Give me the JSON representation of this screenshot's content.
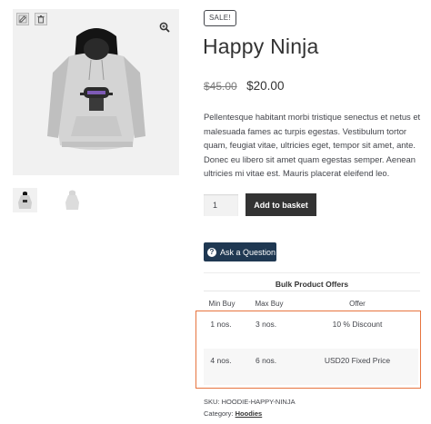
{
  "gallery": {
    "main_alt": "Happy Ninja hoodie product image",
    "tool_icons": [
      "edit-icon",
      "trash-icon"
    ],
    "zoom_icon": "zoom-icon",
    "thumbnails": [
      "hoodie-front-thumbnail",
      "hoodie-back-thumbnail"
    ]
  },
  "product": {
    "badge": "Sale!",
    "title": "Happy Ninja",
    "price_old": "$45.00",
    "price_new": "$20.00",
    "description": "Pellentesque habitant morbi tristique senectus et netus et malesuada fames ac turpis egestas. Vestibulum tortor quam, feugiat vitae, ultricies eget, tempor sit amet, ante. Donec eu libero sit amet quam egestas semper. Aenean ultricies mi vitae est. Mauris placerat eleifend leo.",
    "quantity": "1",
    "add_to_basket": "Add to basket",
    "ask_question": "Ask a Question"
  },
  "offers": {
    "title": "Bulk Product Offers",
    "headers": [
      "Min Buy",
      "Max Buy",
      "Offer"
    ],
    "rows": [
      {
        "min": "1 nos.",
        "max": "3 nos.",
        "offer": "10 % Discount"
      },
      {
        "min": "4 nos.",
        "max": "6 nos.",
        "offer": "USD20 Fixed Price"
      }
    ],
    "highlight_color": "#e7743e"
  },
  "meta": {
    "sku_label": "SKU:",
    "sku_value": "HOODIE-HAPPY-NINJA",
    "category_label": "Category:",
    "category_value": "Hoodies"
  }
}
